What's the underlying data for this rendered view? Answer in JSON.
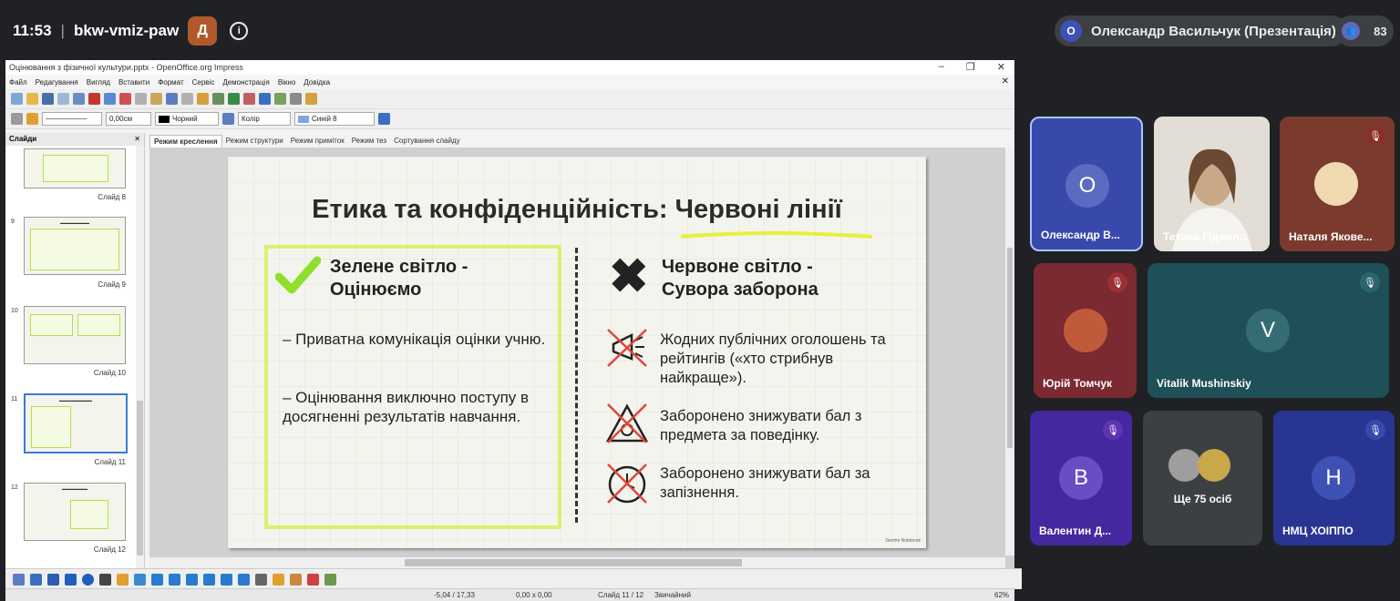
{
  "meeting": {
    "time": "11:53",
    "code": "bkw-vmiz-paw",
    "presenter": "Олександр Васильчук (Презентація)",
    "presenter_initial": "О",
    "participant_count": "83"
  },
  "impress": {
    "window_title": "Оцінювання з фізичної культури.pptx - OpenOffice.org Impress",
    "menu": [
      "Файл",
      "Редагування",
      "Вигляд",
      "Вставити",
      "Формат",
      "Сервіс",
      "Демонстрація",
      "Вікно",
      "Довідка"
    ],
    "line_width": "0,00см",
    "line_color": "Чорний",
    "fill_mode": "Колір",
    "fill_color": "Синій 8",
    "slides_panel_title": "Слайди",
    "slide_labels": [
      "Слайд 8",
      "Слайд 9",
      "Слайд 10",
      "Слайд 11",
      "Слайд 12"
    ],
    "slide_numbers": [
      "9",
      "10",
      "11",
      "12"
    ],
    "view_tabs": [
      "Режим креслення",
      "Режим структури",
      "Режим приміток",
      "Режим тез",
      "Сортування слайду"
    ],
    "status": {
      "position": "-5,04 / 17,33",
      "size": "0,00 x 0,00",
      "slide": "Слайд 11 / 12",
      "layout": "Звичайний",
      "zoom": "62%"
    }
  },
  "slide": {
    "title_main": "Етика та конфіденційність: ",
    "title_highlight": "Червоні лінії",
    "green_heading_1": "Зелене світло -",
    "green_heading_2": "Оцінюємо",
    "green_items": [
      "– Приватна комунікація оцінки учню.",
      "– Оцінювання виключно поступу в досягненні результатів навчання."
    ],
    "red_heading_1": "Червоне світло -",
    "red_heading_2": "Сувора заборона",
    "red_items": [
      "Жодних публічних оголошень та рейтингів («хто стрибнув найкраще»).",
      "Заборонено знижувати бал з предмета за поведінку.",
      "Заборонено знижувати бал за запізнення."
    ],
    "watermark": "Gemini Notebook",
    "colors": {
      "green": "#d9f26e",
      "check": "#8ee02a",
      "red": "#e0463a"
    }
  },
  "participants": [
    {
      "name": "Олександр В...",
      "initial": "О",
      "color": "#3949ab"
    },
    {
      "name": "Тетяна Гіджел...",
      "initial": "",
      "color": "#d8d4cc"
    },
    {
      "name": "Наталя Якове...",
      "initial": "",
      "color": "#7a3b2e"
    },
    {
      "name": "Юрій Томчук",
      "initial": "",
      "color": "#7b2a32"
    },
    {
      "name": "Vitalik Mushinskiy",
      "initial": "V",
      "color": "#1f4f57"
    },
    {
      "name": "Валентин Д...",
      "initial": "В",
      "color": "#4527a0"
    },
    {
      "name": "Ще 75 осіб",
      "initial": "",
      "color": "#3c4043"
    },
    {
      "name": "НМЦ ХОІППО",
      "initial": "Н",
      "color": "#283593"
    }
  ]
}
